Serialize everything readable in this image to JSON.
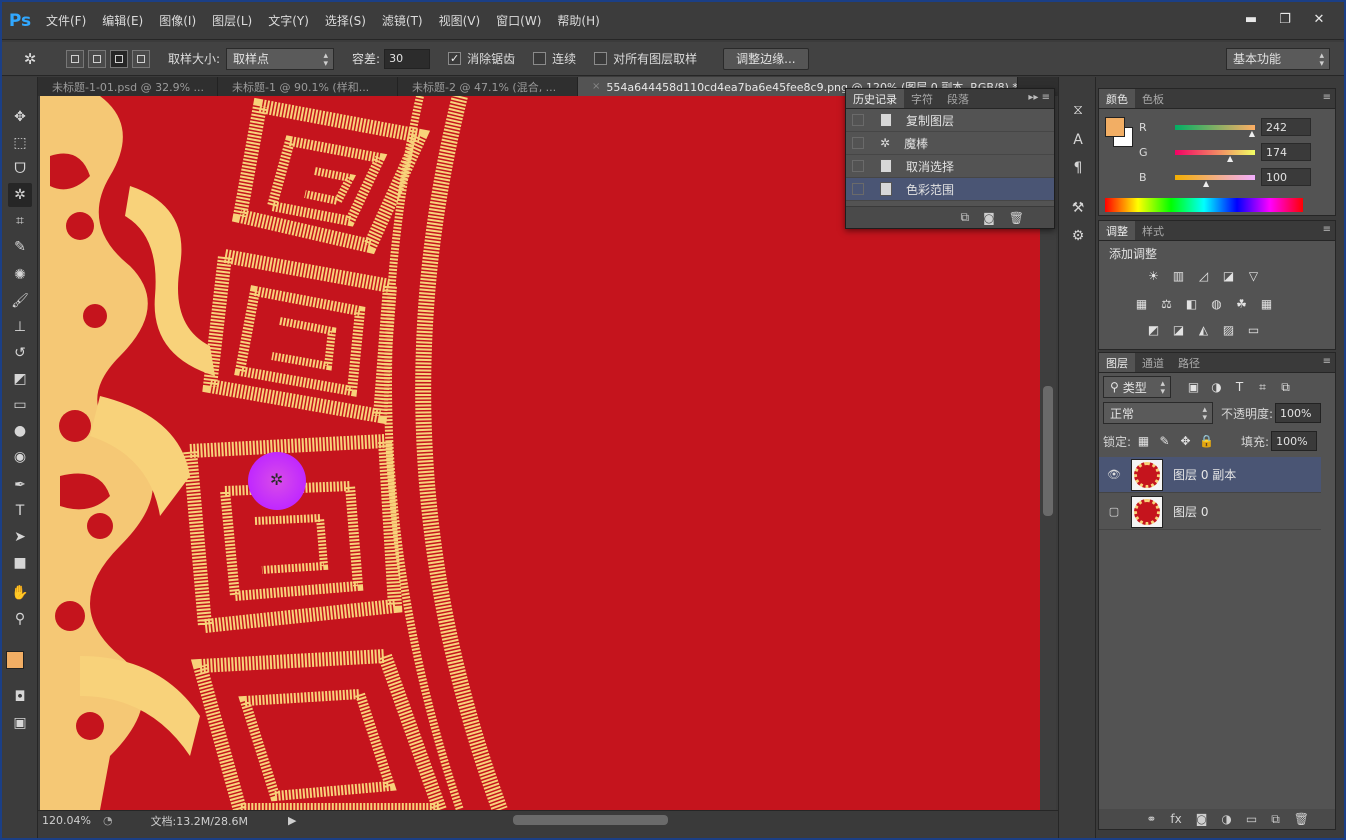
{
  "app": {
    "logo": "Ps"
  },
  "menu": [
    "文件(F)",
    "编辑(E)",
    "图像(I)",
    "图层(L)",
    "文字(Y)",
    "选择(S)",
    "滤镜(T)",
    "视图(V)",
    "窗口(W)",
    "帮助(H)"
  ],
  "window_controls": {
    "minimize": "▬",
    "maximize": "❐",
    "close": "✕"
  },
  "options": {
    "sample_size_label": "取样大小:",
    "sample_size_value": "取样点",
    "tolerance_label": "容差:",
    "tolerance_value": "30",
    "antialias_label": "消除锯齿",
    "antialias_checked": true,
    "contiguous_label": "连续",
    "contiguous_checked": false,
    "sample_all_label": "对所有图层取样",
    "sample_all_checked": false,
    "refine_edge_button": "调整边缘...",
    "workspace": "基本功能"
  },
  "tabs": [
    {
      "label": "未标题-1-01.psd @ 32.9% ...",
      "active": false
    },
    {
      "label": "未标题-1 @ 90.1% (样和...",
      "active": false
    },
    {
      "label": "未标题-2 @ 47.1% (混合, ...",
      "active": false
    },
    {
      "label": "554a644458d110cd4ea7ba6e45fee8c9.png @ 120% (图层 0 副本, RGB/8) *",
      "active": true
    }
  ],
  "status": {
    "zoom": "120.04%",
    "doc": "文档:13.2M/28.6M"
  },
  "history_panel": {
    "tabs": [
      "历史记录",
      "字符",
      "段落"
    ],
    "items": [
      {
        "label": "复制图层",
        "selected": false
      },
      {
        "label": "魔棒",
        "selected": false
      },
      {
        "label": "取消选择",
        "selected": false
      },
      {
        "label": "色彩范围",
        "selected": true
      }
    ]
  },
  "color_panel": {
    "tabs": [
      "颜色",
      "色板"
    ],
    "r": {
      "label": "R",
      "value": "242",
      "fraction": 0.949
    },
    "g": {
      "label": "G",
      "value": "174",
      "fraction": 0.682
    },
    "b": {
      "label": "B",
      "value": "100",
      "fraction": 0.392
    },
    "foreground": "#f2ae64",
    "background": "#ffffff"
  },
  "adjustments_panel": {
    "tabs": [
      "调整",
      "样式"
    ],
    "title": "添加调整"
  },
  "layers_panel": {
    "tabs": [
      "图层",
      "通道",
      "路径"
    ],
    "filter_kind": "类型",
    "blend_mode": "正常",
    "opacity_label": "不透明度:",
    "opacity_value": "100%",
    "lock_label": "锁定:",
    "fill_label": "填充:",
    "fill_value": "100%",
    "layers": [
      {
        "name": "图层 0 副本",
        "visible": true,
        "selected": true
      },
      {
        "name": "图层 0",
        "visible": false,
        "selected": false
      }
    ]
  },
  "colors": {
    "canvas_red": "#c5141d",
    "pattern_gold": "#f8d27a",
    "accent_blue": "#31a8ff",
    "selection_highlight": "#4a5574"
  }
}
